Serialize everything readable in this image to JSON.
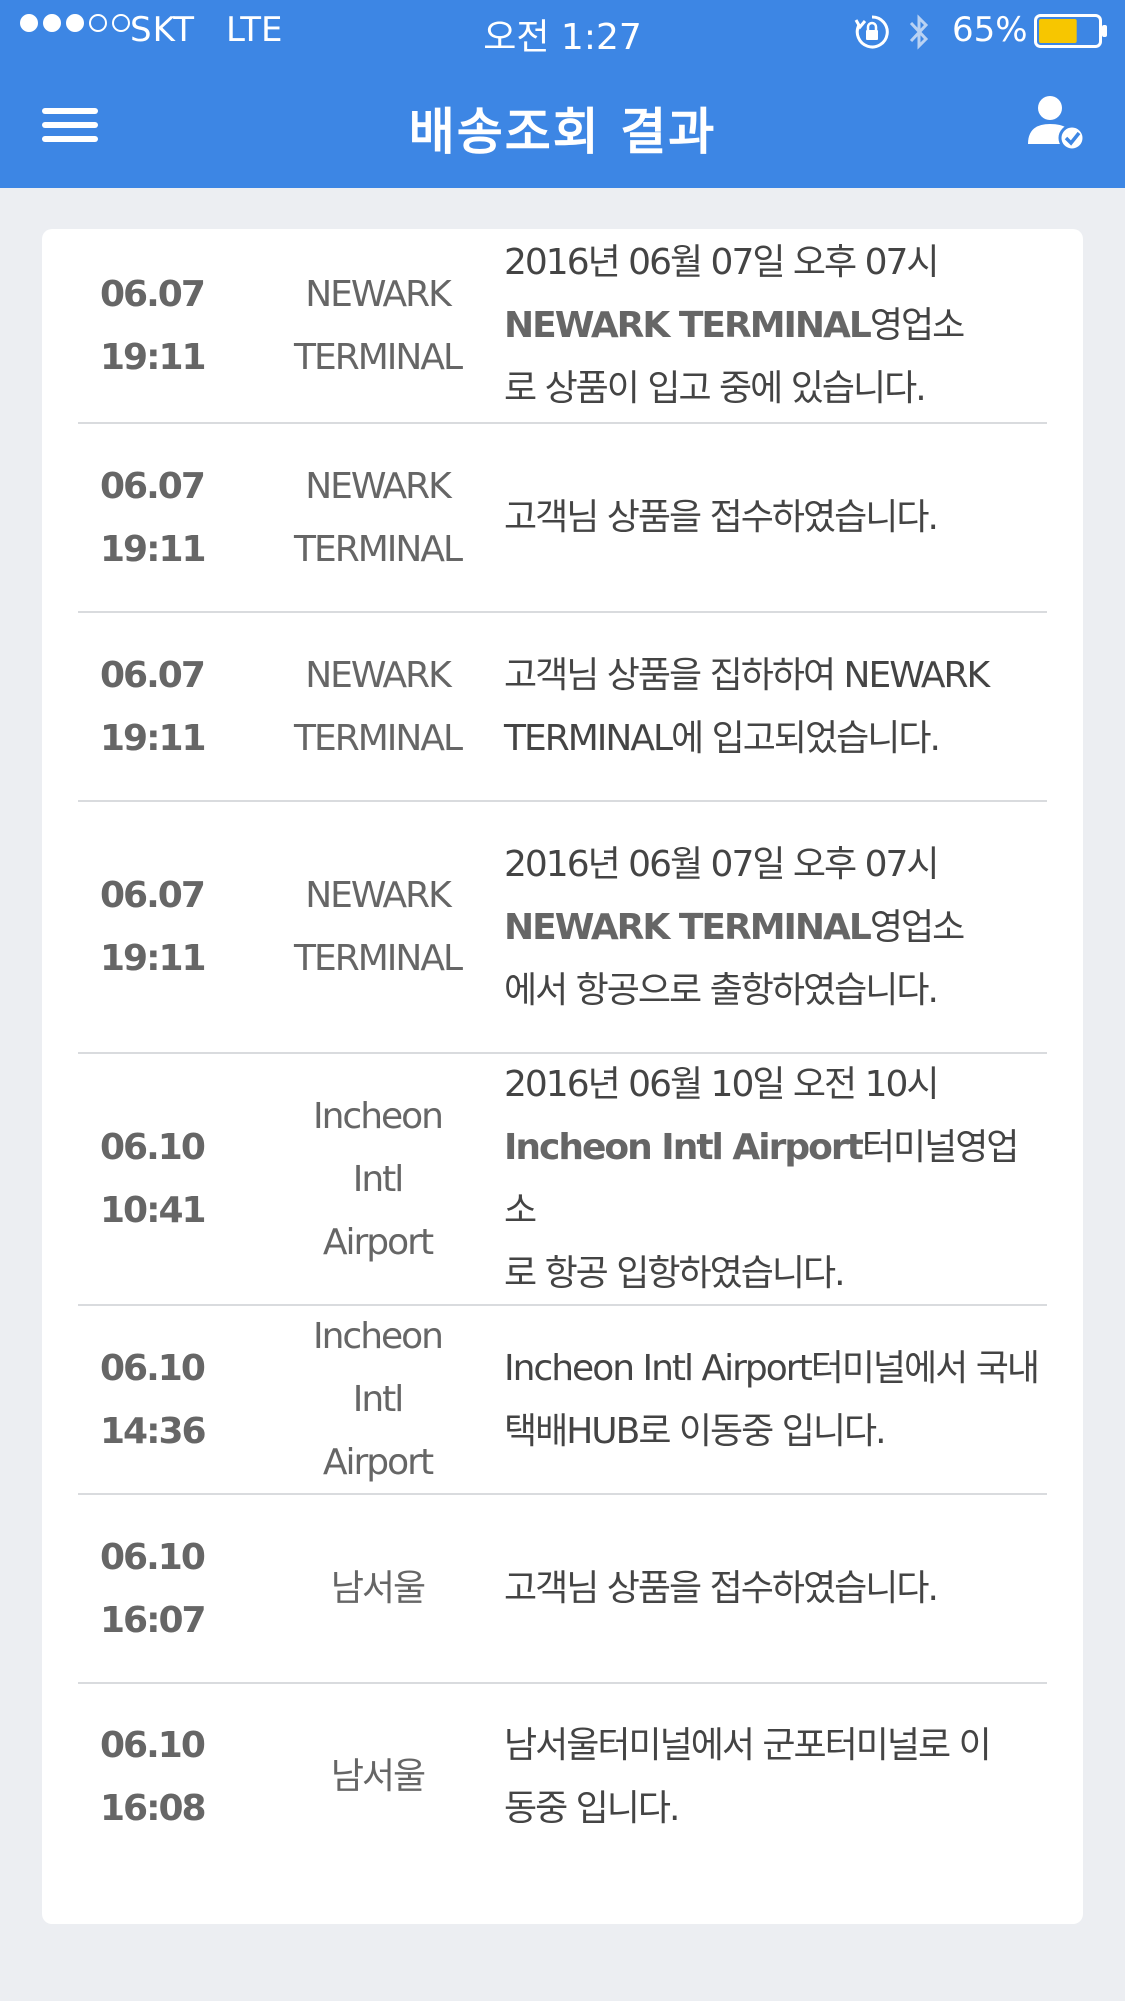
{
  "status_bar": {
    "carrier": "SKT",
    "network": "LTE",
    "time": "오전 1:27",
    "battery": "65%",
    "battery_level": 0.65
  },
  "nav": {
    "title": "배송조회 결과"
  },
  "colors": {
    "header": "#3d86e4",
    "background": "#eceef2",
    "battery_fill": "#f7c600"
  },
  "rows": [
    {
      "date": "06.07",
      "time": "19:11",
      "location": [
        "NEWARK",
        "TERMINAL"
      ],
      "desc": [
        [
          "2016년 06월 07일 오후 07시"
        ],
        [
          {
            "b": "NEWARK TERMINAL"
          },
          "영업소"
        ],
        [
          "로 상품이 입고 중에 있습니다."
        ]
      ],
      "height": 195
    },
    {
      "date": "06.07",
      "time": "19:11",
      "location": [
        "NEWARK",
        "TERMINAL"
      ],
      "desc": [
        [
          "고객님 상품을 접수하였습니다."
        ]
      ],
      "height": 189
    },
    {
      "date": "06.07",
      "time": "19:11",
      "location": [
        "NEWARK",
        "TERMINAL"
      ],
      "desc": [
        [
          "고객님 상품을 집하하여 NEWARK"
        ],
        [
          "TERMINAL에 입고되었습니다."
        ]
      ],
      "height": 189
    },
    {
      "date": "06.07",
      "time": "19:11",
      "location": [
        "NEWARK",
        "TERMINAL"
      ],
      "desc": [
        [
          "2016년 06월 07일 오후 07시"
        ],
        [
          {
            "b": "NEWARK TERMINAL"
          },
          "영업소"
        ],
        [
          "에서 항공으로 출항하였습니다."
        ]
      ],
      "height": 252
    },
    {
      "date": "06.10",
      "time": "10:41",
      "location": [
        "Incheon Intl",
        "Airport"
      ],
      "desc": [
        [
          "2016년 06월 10일 오전 10시"
        ],
        [
          {
            "b": "Incheon Intl Airport"
          },
          "터미널영업소"
        ],
        [
          "로 항공 입항하였습니다."
        ]
      ],
      "height": 252
    },
    {
      "date": "06.10",
      "time": "14:36",
      "location": [
        "Incheon Intl",
        "Airport"
      ],
      "desc": [
        [
          "Incheon Intl Airport터미널에서 국내"
        ],
        [
          "택배HUB로 이동중 입니다."
        ]
      ],
      "height": 189
    },
    {
      "date": "06.10",
      "time": "16:07",
      "location": [
        "남서울"
      ],
      "desc": [
        [
          "고객님 상품을 접수하였습니다."
        ]
      ],
      "height": 189
    },
    {
      "date": "06.10",
      "time": "16:08",
      "location": [
        "남서울"
      ],
      "desc": [
        [
          "남서울터미널에서 군포터미널로 이"
        ],
        [
          "동중 입니다."
        ]
      ],
      "height": 185
    }
  ]
}
